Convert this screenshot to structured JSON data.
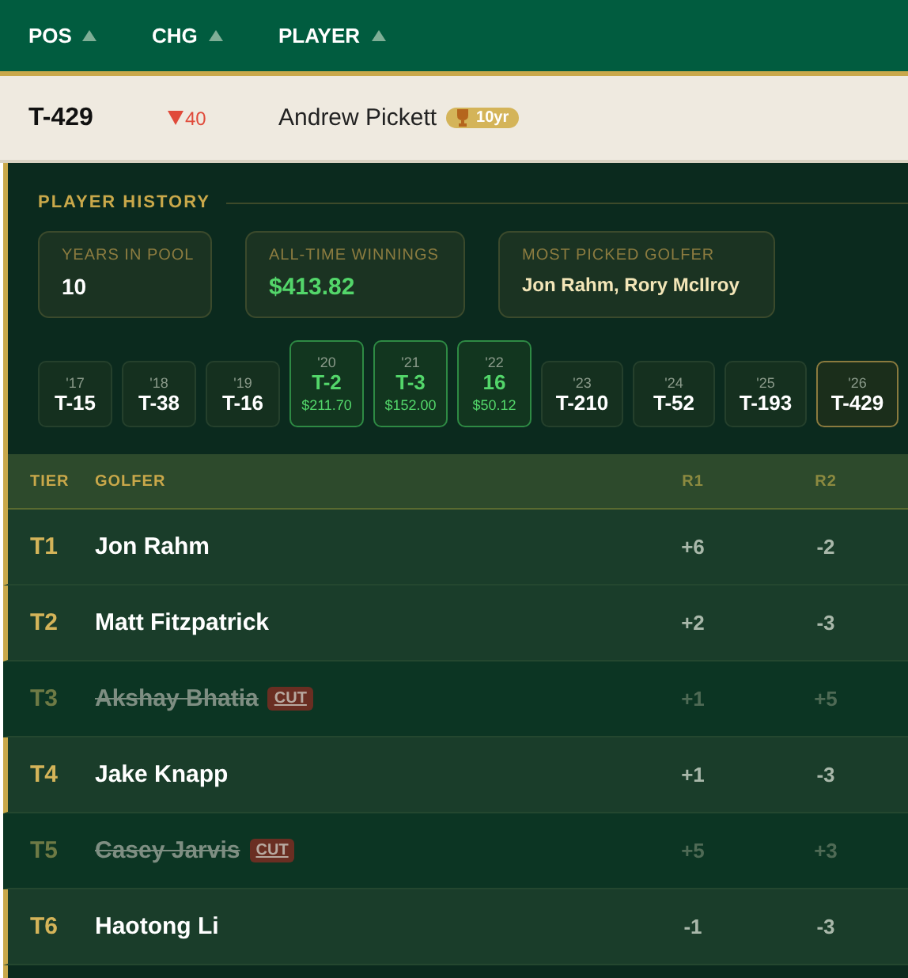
{
  "columns": [
    {
      "label": "POS"
    },
    {
      "label": "CHG"
    },
    {
      "label": "PLAYER"
    }
  ],
  "player": {
    "position": "T-429",
    "change": {
      "down": true,
      "amount": "40"
    },
    "name": "Andrew Pickett",
    "badge": "10yr"
  },
  "history": {
    "title": "PLAYER HISTORY",
    "stats": [
      {
        "label": "YEARS IN POOL",
        "value": "10",
        "kind": "plain"
      },
      {
        "label": "ALL-TIME WINNINGS",
        "value": "$413.82",
        "kind": "money"
      },
      {
        "label": "MOST PICKED GOLFER",
        "value": "Jon Rahm, Rory McIlroy",
        "kind": "names"
      }
    ],
    "years": [
      {
        "year": "'17",
        "result": "T-15",
        "kind": "normal"
      },
      {
        "year": "'18",
        "result": "T-38",
        "kind": "normal"
      },
      {
        "year": "'19",
        "result": "T-16",
        "kind": "normal"
      },
      {
        "year": "'20",
        "result": "T-2",
        "winnings": "$211.70",
        "kind": "paid"
      },
      {
        "year": "'21",
        "result": "T-3",
        "winnings": "$152.00",
        "kind": "paid"
      },
      {
        "year": "'22",
        "result": "16",
        "winnings": "$50.12",
        "kind": "paid"
      },
      {
        "year": "'23",
        "result": "T-210",
        "kind": "normal"
      },
      {
        "year": "'24",
        "result": "T-52",
        "kind": "normal"
      },
      {
        "year": "'25",
        "result": "T-193",
        "kind": "normal"
      },
      {
        "year": "'26",
        "result": "T-429",
        "kind": "current"
      }
    ]
  },
  "picks": {
    "columns": [
      {
        "label": "TIER"
      },
      {
        "label": "GOLFER"
      },
      {
        "label": "R1"
      },
      {
        "label": "R2"
      }
    ],
    "rows": [
      {
        "tier": "T1",
        "golfer": "Jon Rahm",
        "cut": false,
        "r1": "+6",
        "r2": "-2"
      },
      {
        "tier": "T2",
        "golfer": "Matt Fitzpatrick",
        "cut": false,
        "r1": "+2",
        "r2": "-3"
      },
      {
        "tier": "T3",
        "golfer": "Akshay Bhatia",
        "cut": true,
        "cut_label": "CUT",
        "r1": "+1",
        "r2": "+5"
      },
      {
        "tier": "T4",
        "golfer": "Jake Knapp",
        "cut": false,
        "r1": "+1",
        "r2": "-3"
      },
      {
        "tier": "T5",
        "golfer": "Casey Jarvis",
        "cut": true,
        "cut_label": "CUT",
        "r1": "+5",
        "r2": "+3"
      },
      {
        "tier": "T6",
        "golfer": "Haotong Li",
        "cut": false,
        "r1": "-1",
        "r2": "-3"
      }
    ]
  }
}
